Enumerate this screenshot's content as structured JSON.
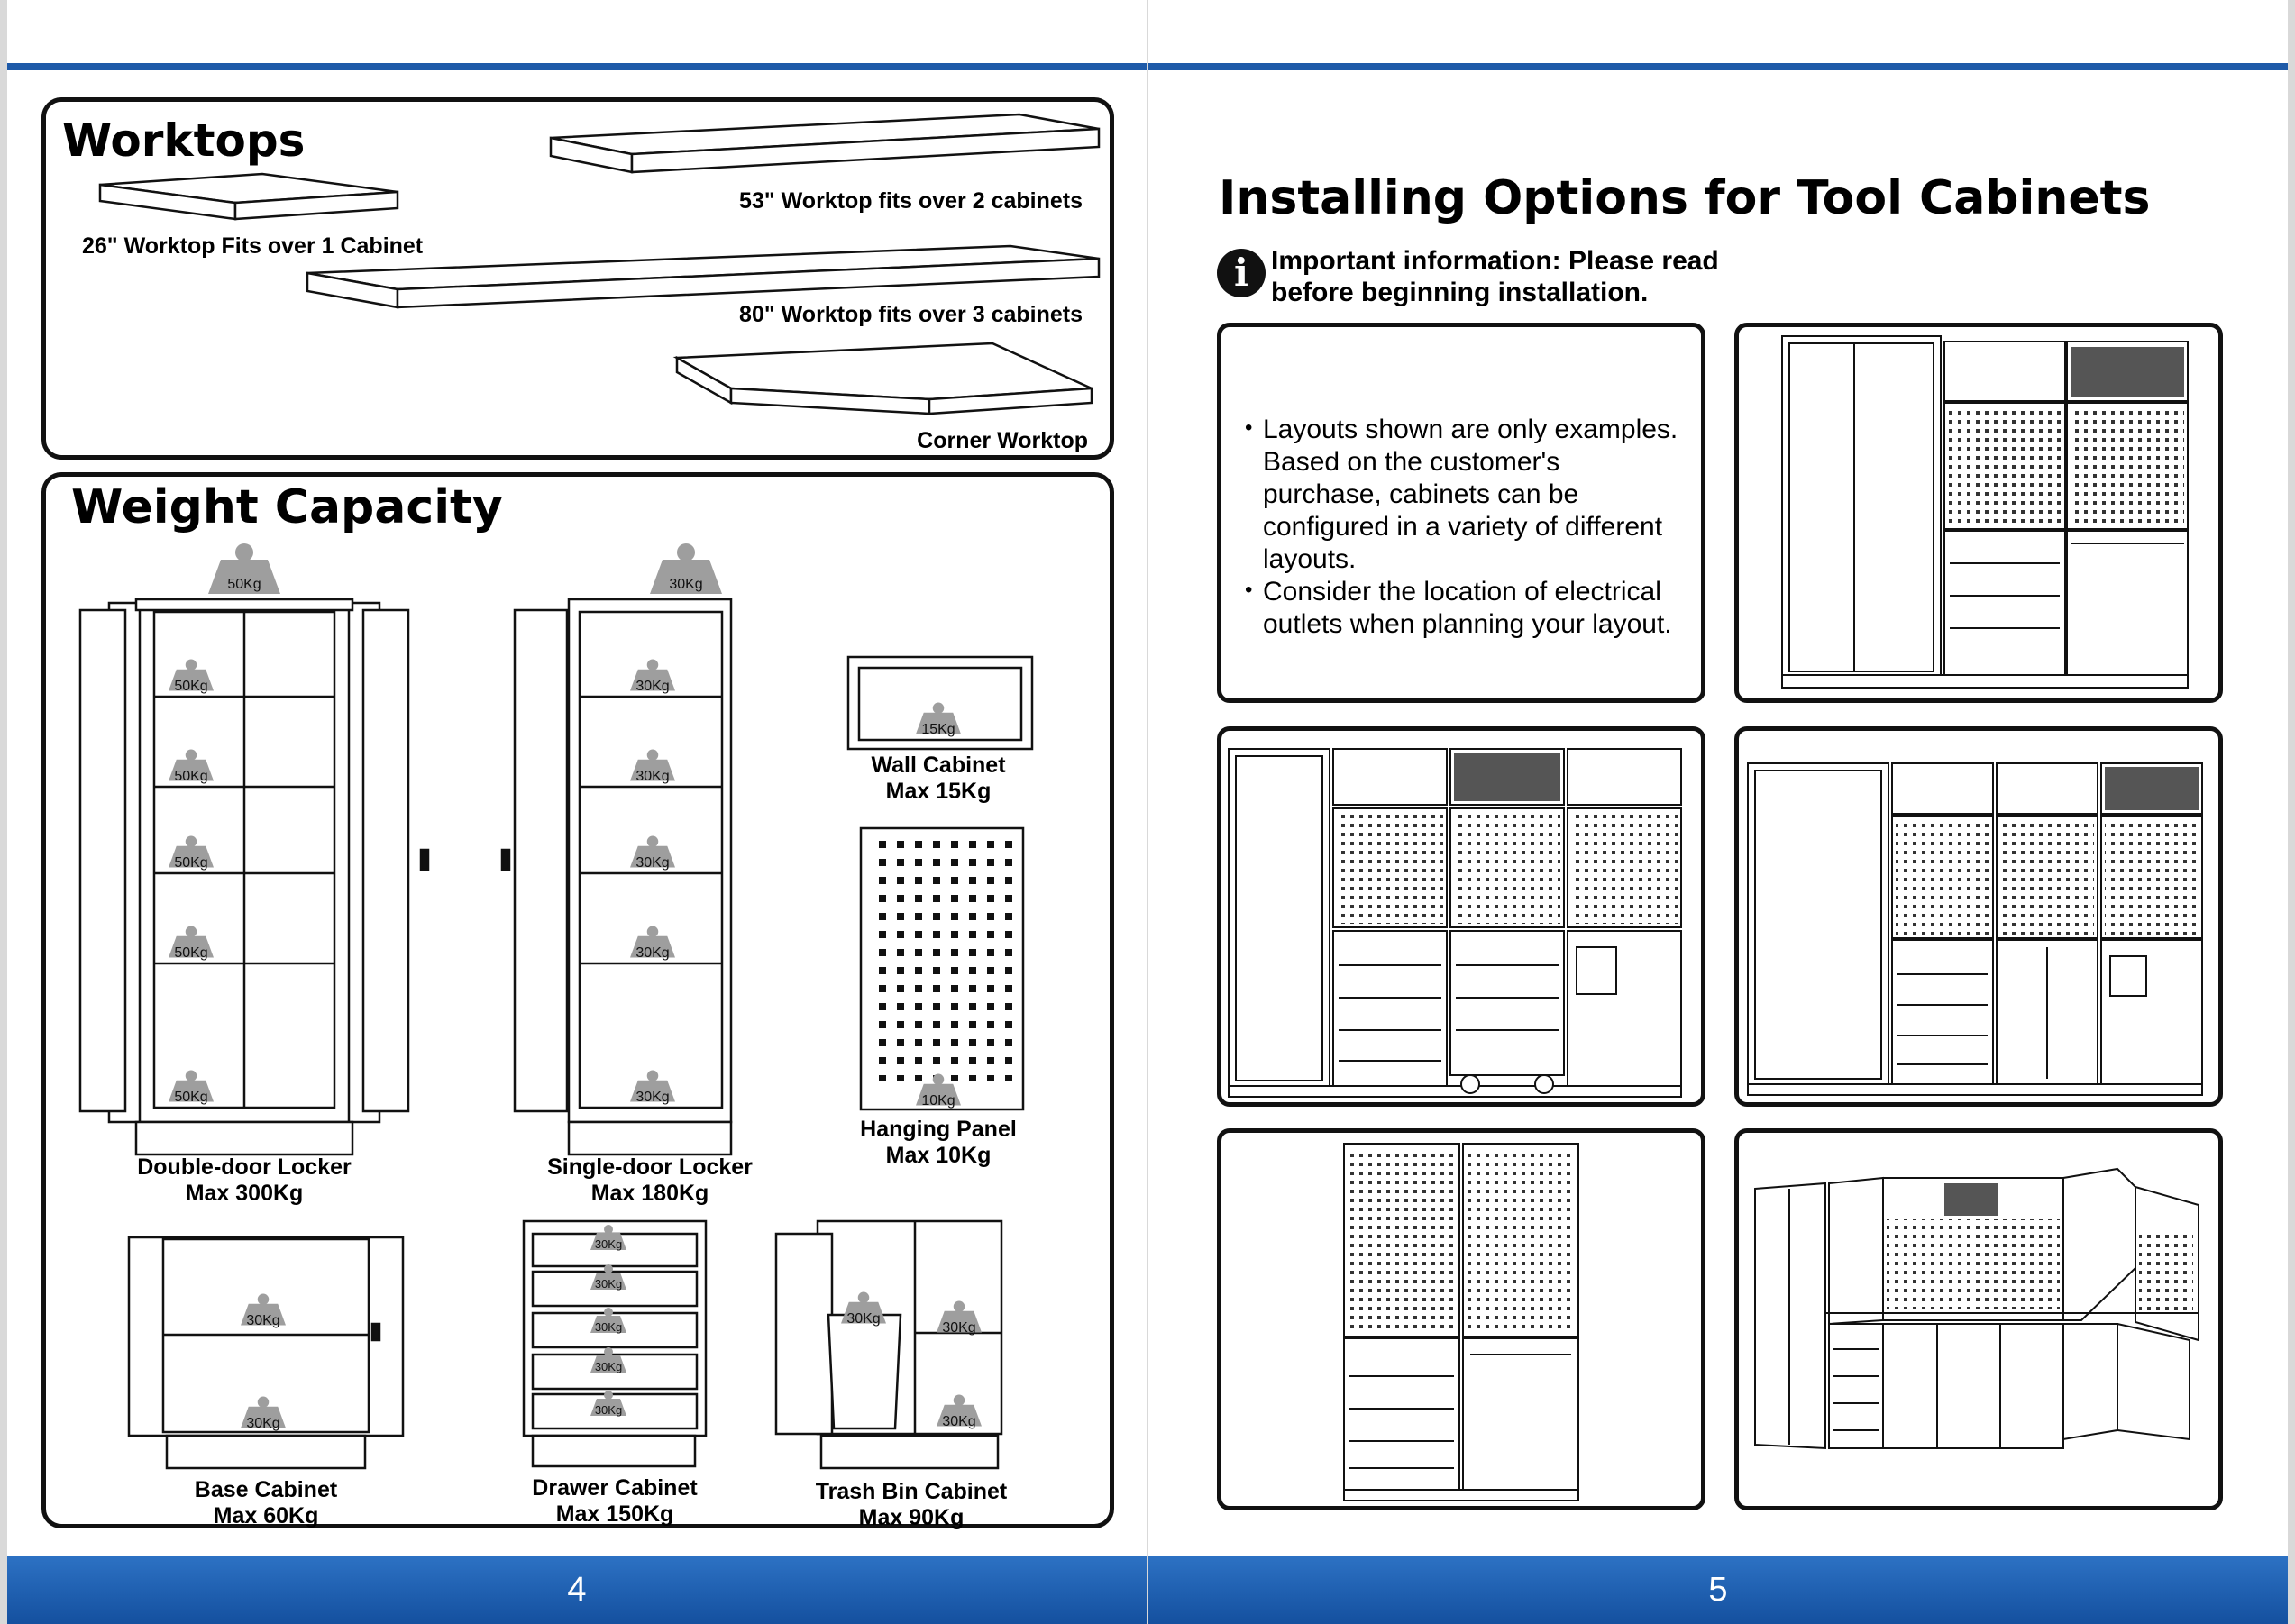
{
  "left_page": {
    "page_number": "4",
    "worktops": {
      "title": "Worktops",
      "items": [
        {
          "label": "26\" Worktop Fits over 1 Cabinet"
        },
        {
          "label": "53\" Worktop fits over 2 cabinets"
        },
        {
          "label": "80\" Worktop fits over 3 cabinets"
        },
        {
          "label": "Corner Worktop"
        }
      ]
    },
    "weight_capacity": {
      "title": "Weight Capacity",
      "double_door": {
        "name": "Double-door Locker",
        "max": "Max 300Kg",
        "top": "50Kg",
        "shelves": [
          "50Kg",
          "50Kg",
          "50Kg",
          "50Kg",
          "50Kg"
        ]
      },
      "single_door": {
        "name": "Single-door Locker",
        "max": "Max 180Kg",
        "top": "30Kg",
        "shelves": [
          "30Kg",
          "30Kg",
          "30Kg",
          "30Kg",
          "30Kg"
        ]
      },
      "wall_cabinet": {
        "name": "Wall Cabinet",
        "max": "Max 15Kg",
        "load": "15Kg"
      },
      "hanging_panel": {
        "name": "Hanging Panel",
        "max": "Max 10Kg",
        "load": "10Kg"
      },
      "base_cabinet": {
        "name": "Base Cabinet",
        "max": "Max 60Kg",
        "shelves": [
          "30Kg",
          "30Kg"
        ]
      },
      "drawer_cabinet": {
        "name": "Drawer Cabinet",
        "max": "Max 150Kg",
        "drawers": [
          "30Kg",
          "30Kg",
          "30Kg",
          "30Kg",
          "30Kg"
        ]
      },
      "trash_bin": {
        "name": "Trash Bin Cabinet",
        "max": "Max 90Kg",
        "loads": [
          "30Kg",
          "30Kg",
          "30Kg"
        ]
      }
    }
  },
  "right_page": {
    "page_number": "5",
    "title": "Installing Options for Tool Cabinets",
    "important": "Important information: Please read before beginning installation.",
    "important_line1": "Important information: Please read",
    "important_line2": "before beginning installation.",
    "notes": [
      "Layouts shown are only examples. Based on the customer's purchase, cabinets can be configured in a variety of different layouts.",
      "Consider the location of electrical outlets when planning your layout."
    ]
  }
}
